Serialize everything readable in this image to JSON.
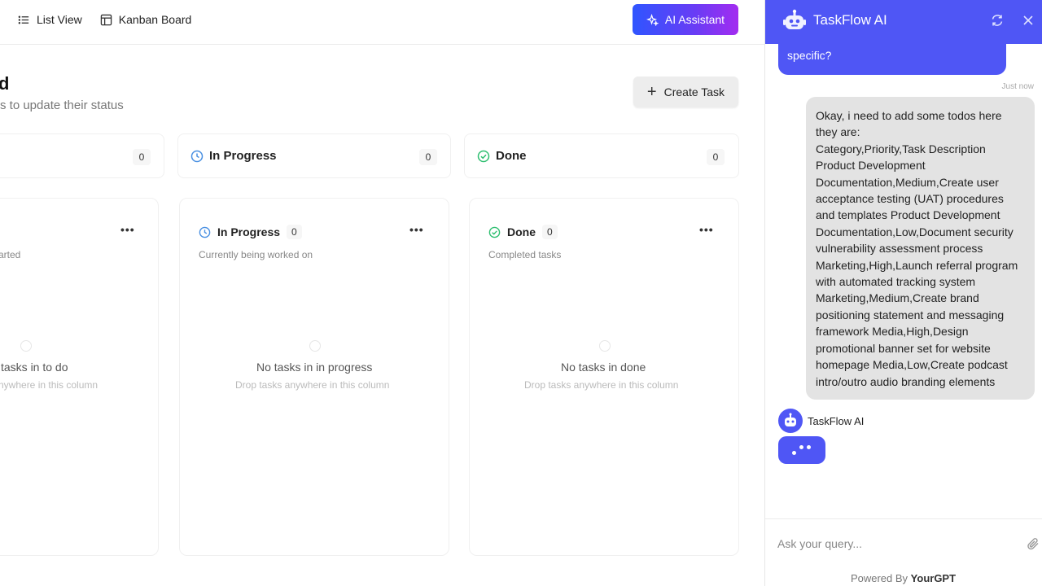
{
  "toolbar": {
    "tabs": [
      {
        "label": "List View",
        "icon": "list-icon"
      },
      {
        "label": "Kanban Board",
        "icon": "board-icon"
      }
    ],
    "ai_button": "AI Assistant"
  },
  "board": {
    "title_fragment": "d",
    "subtitle_fragment": "s to update their status",
    "create_button": "Create Task",
    "summary": [
      {
        "label": "",
        "count": "0"
      },
      {
        "label": "In Progress",
        "count": "0",
        "color": "#4a90e2"
      },
      {
        "label": "Done",
        "count": "0",
        "color": "#2fbf71"
      }
    ],
    "columns": [
      {
        "desc_fragment": "arted",
        "empty_title": "tasks in to do",
        "empty_hint": "nywhere in this column"
      },
      {
        "title": "In Progress",
        "count": "0",
        "desc": "Currently being worked on",
        "empty_title": "No tasks in in progress",
        "empty_hint": "Drop tasks anywhere in this column"
      },
      {
        "title": "Done",
        "count": "0",
        "desc": "Completed tasks",
        "empty_title": "No tasks in done",
        "empty_hint": "Drop tasks anywhere in this column"
      }
    ]
  },
  "chat": {
    "title": "TaskFlow AI",
    "header_color": "#4f56f5",
    "bot_message_tail": "specific?",
    "time": "Just now",
    "user_message": "Okay, i need to add some todos here they are:\nCategory,Priority,Task Description Product Development Documentation,Medium,Create user acceptance testing (UAT) procedures and templates Product Development Documentation,Low,Document security vulnerability assessment process Marketing,High,Launch referral program with automated tracking system Marketing,Medium,Create brand positioning statement and messaging framework Media,High,Design promotional banner set for website homepage Media,Low,Create podcast intro/outro audio branding elements",
    "bot_name": "TaskFlow AI",
    "input_placeholder": "Ask your query...",
    "powered_by": "Powered By",
    "powered_brand": "YourGPT"
  }
}
